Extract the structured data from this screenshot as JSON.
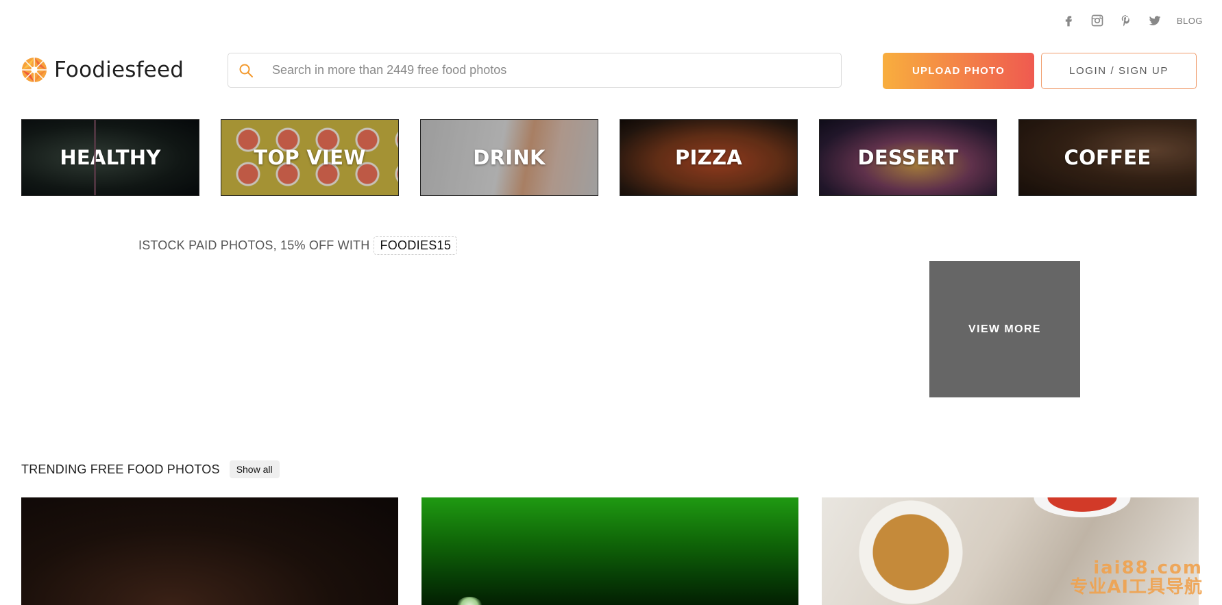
{
  "topbar": {
    "social": [
      "facebook-icon",
      "instagram-icon",
      "pinterest-icon",
      "twitter-icon"
    ],
    "blog_label": "BLOG"
  },
  "header": {
    "logo_text": "Foodiesfeed",
    "search_placeholder": "Search in more than 2449 free food photos",
    "upload_label": "UPLOAD PHOTO",
    "login_label": "LOGIN / SIGN UP"
  },
  "categories": [
    {
      "label": "HEALTHY"
    },
    {
      "label": "TOP VIEW"
    },
    {
      "label": "DRINK"
    },
    {
      "label": "PIZZA"
    },
    {
      "label": "DESSERT"
    },
    {
      "label": "COFFEE"
    }
  ],
  "promo": {
    "text": "ISTOCK PAID PHOTOS, 15% OFF WITH",
    "code": "FOODIES15",
    "view_more_label": "VIEW MORE"
  },
  "trending": {
    "title": "TRENDING FREE FOOD PHOTOS",
    "show_all_label": "Show all"
  },
  "watermark": {
    "line1": "iai88.com",
    "line2": "专业AI工具导航"
  },
  "colors": {
    "accent_start": "#f8ae3e",
    "accent_end": "#ef5a50",
    "view_more_bg": "#666666"
  }
}
